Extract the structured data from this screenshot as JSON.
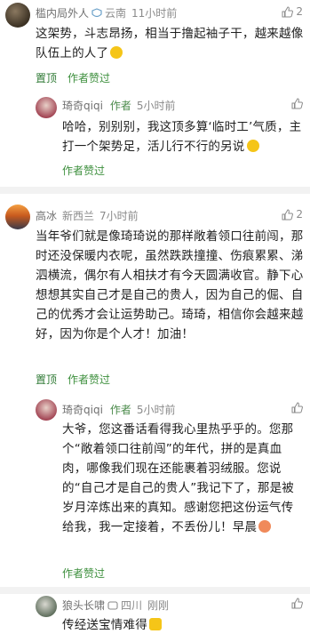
{
  "comments": [
    {
      "user": "槛内局外人",
      "location": "云南",
      "time": "11小时前",
      "likes": "2",
      "text": "这架势，斗志昂扬，相当于撸起袖子干，越来越像队伍上的人了",
      "actions": {
        "top": "置顶",
        "liked": "作者赞过"
      },
      "reply": {
        "user": "琦奇qiqi",
        "author_tag": "作者",
        "time": "5小时前",
        "text": "哈哈，别别别，我这顶多算‘临时工’气质，主打一个架势足，活儿行不行的另说",
        "liked": "作者赞过"
      }
    },
    {
      "user": "高冰",
      "location": "新西兰",
      "time": "7小时前",
      "likes": "2",
      "text": "当年爷们就是像琦琦说的那样敞着领口往前闯，那时还没保暖内衣呢，虽然跌跌撞撞、伤痕累累、涕泗横流，偶尔有人相扶才有今天圆满收官。静下心想想其实自己才是自己的贵人，因为自己的倔、自己的优秀才会让运势助己。琦琦，相信你会越来越好，因为你是个人才！加油！",
      "actions": {
        "top": "置顶",
        "liked": "作者赞过"
      },
      "reply": {
        "user": "琦奇qiqi",
        "author_tag": "作者",
        "time": "5小时前",
        "text": "大爷，您这番话看得我心里热乎乎的。您那个“敞着领口往前闯”的年代，拼的是真血肉，哪像我们现在还能裹着羽绒服。您说的“自己才是自己的贵人”我记下了，那是被岁月淬炼出来的真知。感谢您把这份运气传给我，我一定接着，不丢份儿！早晨",
        "liked": "作者赞过"
      }
    },
    {
      "user": "狼头长啸",
      "location": "四川",
      "time": "刚刚",
      "likes": "",
      "text": "传经送宝情难得",
      "reply": null
    }
  ],
  "colors": {
    "accent": "#2f7a35",
    "muted": "#8a8a8a"
  }
}
